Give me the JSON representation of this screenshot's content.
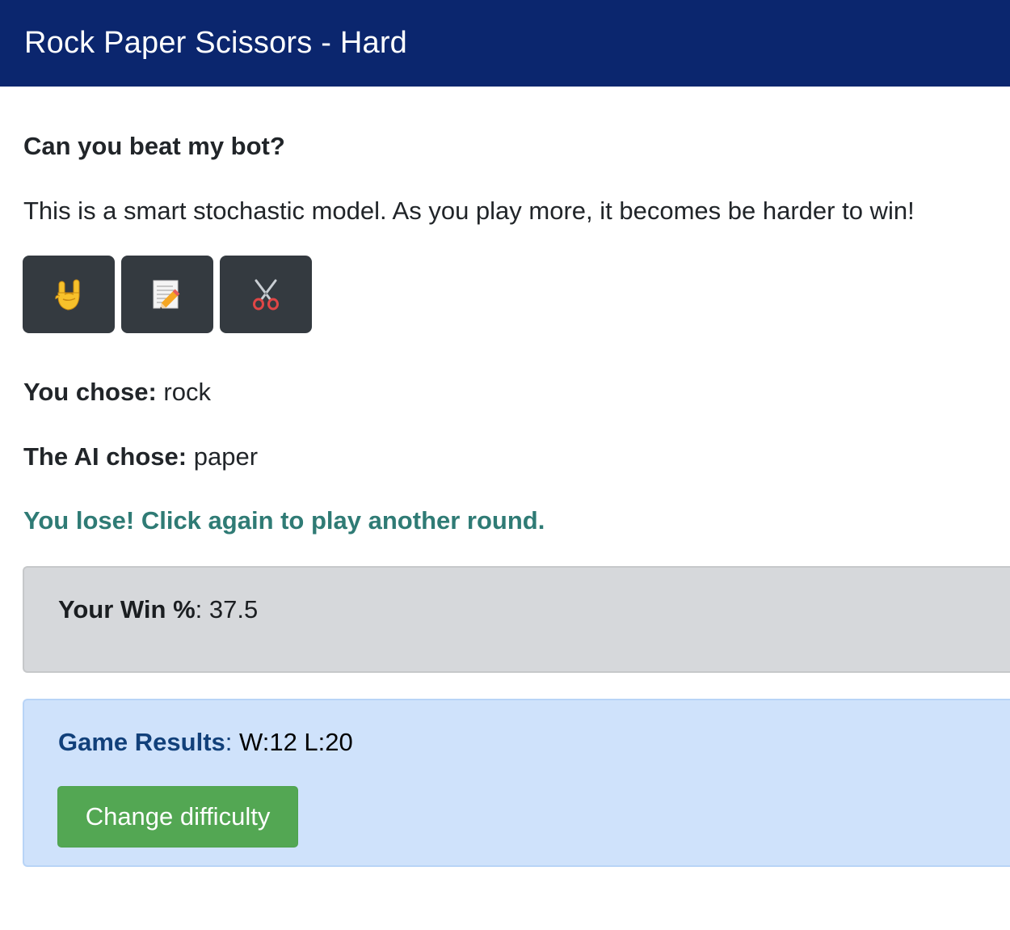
{
  "navbar": {
    "title": "Rock Paper Scissors - Hard"
  },
  "main": {
    "heading": "Can you beat my bot?",
    "intro": "This is a smart stochastic model. As you play more, it becomes be harder to win!",
    "choices": [
      {
        "name": "rock",
        "icon": "sign-of-the-horns-icon"
      },
      {
        "name": "paper",
        "icon": "memo-pencil-icon"
      },
      {
        "name": "scissors",
        "icon": "scissors-icon"
      }
    ],
    "you_chose_label": "You chose:",
    "you_chose_value": "rock",
    "ai_chose_label": "The AI chose:",
    "ai_chose_value": "paper",
    "result_message": "You lose! Click again to play another round.",
    "win_pct_label": "Your Win %",
    "win_pct_colon": ":",
    "win_pct_value": "37.5",
    "results_label": "Game Results",
    "results_colon": ":",
    "results_value": "W:12 L:20",
    "change_difficulty_label": "Change difficulty"
  },
  "colors": {
    "navbar_bg": "#0b266e",
    "choice_button_bg": "#343a40",
    "result_text": "#2f7b75",
    "win_box_bg": "#d6d8db",
    "results_box_bg": "#cfe2fb",
    "results_label": "#11407a",
    "change_difficulty_bg": "#53a753"
  }
}
